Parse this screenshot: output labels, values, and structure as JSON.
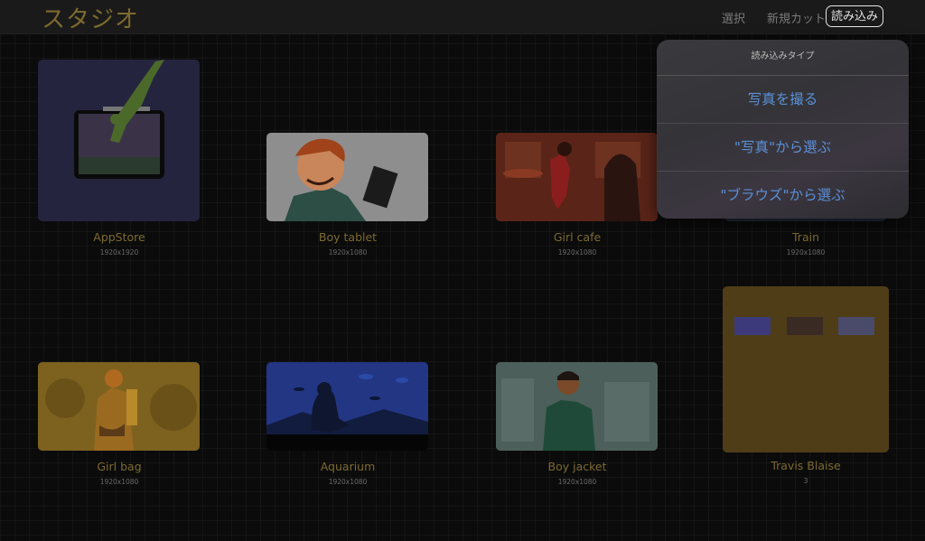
{
  "header": {
    "app_title": "スタジオ",
    "select_label": "選択",
    "new_cut_label": "新規カット",
    "import_label": "読み込み"
  },
  "projects": [
    {
      "name": "AppStore",
      "size": "1920x1920"
    },
    {
      "name": "Boy tablet",
      "size": "1920x1080"
    },
    {
      "name": "Girl cafe",
      "size": "1920x1080"
    },
    {
      "name": "Train",
      "size": "1920x1080"
    },
    {
      "name": "Girl bag",
      "size": "1920x1080"
    },
    {
      "name": "Aquarium",
      "size": "1920x1080"
    },
    {
      "name": "Boy jacket",
      "size": "1920x1080"
    },
    {
      "name": "Travis Blaise",
      "size": "3"
    }
  ],
  "import_menu": {
    "title": "読み込みタイプ",
    "items": [
      "写真を撮る",
      "\"写真\"から選ぶ",
      "\"ブラウズ\"から選ぶ"
    ]
  },
  "colors": {
    "accent_title": "#7e6a2e",
    "menu_item": "#5b8fd6",
    "folder": "#4f3d17"
  }
}
